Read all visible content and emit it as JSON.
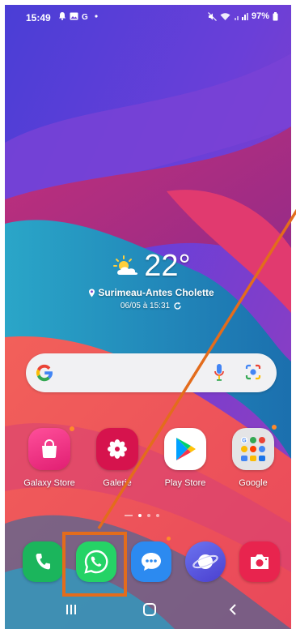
{
  "status_bar": {
    "time": "15:49",
    "left_icons": [
      "alarm-icon",
      "gallery-icon",
      "google-icon",
      "dot-icon"
    ],
    "right_icons": [
      "mute-icon",
      "wifi-icon",
      "signal-icon"
    ],
    "battery": "97%"
  },
  "weather": {
    "temperature": "22°",
    "condition_icon": "partly-sunny-icon",
    "location": "Surimeau-Antes Cholette",
    "updated": "06/05 à 15:31"
  },
  "search": {
    "provider": "Google",
    "icons": [
      "google-g-icon",
      "microphone-icon",
      "lens-icon"
    ]
  },
  "home_apps": [
    {
      "label": "Galaxy Store",
      "icon": "shopping-bag-icon",
      "color": "#e8207a",
      "badge": true
    },
    {
      "label": "Galerie",
      "icon": "flower-icon",
      "color": "#d6134d",
      "badge": false
    },
    {
      "label": "Play Store",
      "icon": "play-icon",
      "color": "#ffffff",
      "badge": false
    },
    {
      "label": "Google",
      "icon": "folder-icon",
      "color": "#e6e6e6",
      "badge": true
    }
  ],
  "page_indicator": {
    "pages": 3,
    "active": 1
  },
  "dock": [
    {
      "name": "Téléphone",
      "icon": "phone-icon",
      "color": "#1bb55c"
    },
    {
      "name": "WhatsApp",
      "icon": "whatsapp-icon",
      "color": "#25d366"
    },
    {
      "name": "Messages",
      "icon": "message-icon",
      "color": "#2c8af0"
    },
    {
      "name": "Internet",
      "icon": "planet-icon",
      "color": "#5a5fe0"
    },
    {
      "name": "Caméra",
      "icon": "camera-icon",
      "color": "#e8244e"
    }
  ],
  "nav_bar": {
    "icons": [
      "recents-icon",
      "home-icon",
      "back-icon"
    ]
  },
  "annotation": {
    "color": "#e36c1c",
    "target": "WhatsApp"
  }
}
